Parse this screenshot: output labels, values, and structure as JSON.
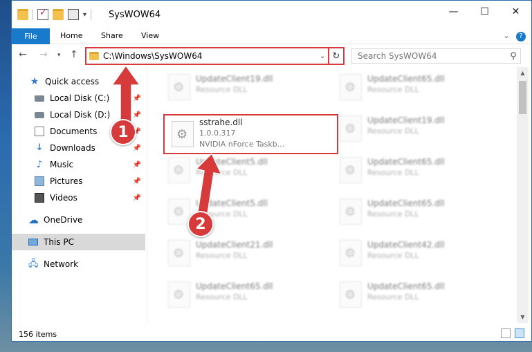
{
  "window": {
    "title": "SysWOW64",
    "controls": {
      "minimize": "—",
      "maximize": "☐",
      "close": "✕"
    }
  },
  "ribbon": {
    "tabs": [
      "File",
      "Home",
      "Share",
      "View"
    ]
  },
  "address_bar": {
    "path": "C:\\Windows\\SysWOW64",
    "search_placeholder": "Search SysWOW64"
  },
  "nav_pane": {
    "items": [
      {
        "label": "Quick access",
        "icon": "star-icon"
      },
      {
        "label": "Local Disk (C:)",
        "icon": "disk-icon",
        "pinned": true
      },
      {
        "label": "Local Disk (D:)",
        "icon": "disk-icon",
        "pinned": true
      },
      {
        "label": "Documents",
        "icon": "documents-icon",
        "pinned": true
      },
      {
        "label": "Downloads",
        "icon": "download-icon",
        "pinned": true
      },
      {
        "label": "Music",
        "icon": "music-icon",
        "pinned": true
      },
      {
        "label": "Pictures",
        "icon": "pictures-icon",
        "pinned": true
      },
      {
        "label": "Videos",
        "icon": "videos-icon",
        "pinned": true
      },
      {
        "label": "OneDrive",
        "icon": "cloud-icon"
      },
      {
        "label": "This PC",
        "icon": "pc-icon",
        "selected": true
      },
      {
        "label": "Network",
        "icon": "network-icon"
      }
    ]
  },
  "files": {
    "left_column": [
      {
        "name": "UpdateClient19.dll",
        "type": "Resource DLL"
      },
      {
        "name": "sstrahe.dll",
        "version": "1.0.0.317",
        "description": "NVIDIA nForce Taskb...",
        "highlighted": true
      },
      {
        "name": "UpdateClient5.dll",
        "type": "Resource DLL"
      },
      {
        "name": "UpdateClient5.dll",
        "type": "Resource DLL"
      },
      {
        "name": "UpdateClient21.dll",
        "type": "Resource DLL"
      },
      {
        "name": "UpdateClient65.dll",
        "type": "Resource DLL"
      }
    ],
    "right_column": [
      {
        "name": "UpdateClient65.dll",
        "type": "Resource DLL"
      },
      {
        "name": "UpdateClient19.dll",
        "type": "Resource DLL"
      },
      {
        "name": "UpdateClient65.dll",
        "type": "Resource DLL"
      },
      {
        "name": "UpdateClient65.dll",
        "type": "Resource DLL"
      },
      {
        "name": "UpdateClient42.dll",
        "type": "Resource DLL"
      },
      {
        "name": "UpdateClient65.dll",
        "type": "Resource DLL"
      }
    ]
  },
  "status": {
    "item_count": "156 items"
  },
  "annotations": {
    "step1": "1",
    "step2": "2",
    "color": "#d63a3a"
  }
}
